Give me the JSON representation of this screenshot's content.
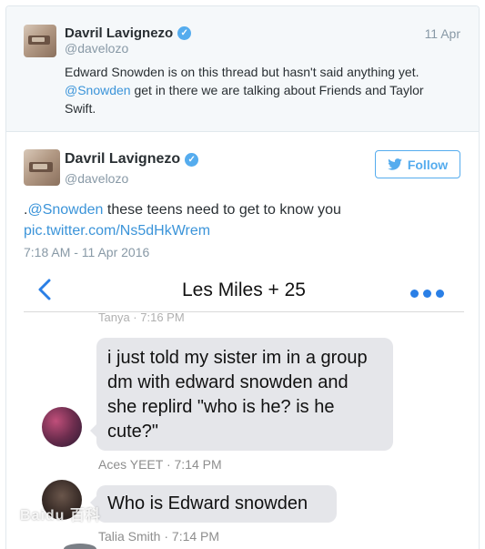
{
  "parent_tweet": {
    "author_name": "Davril Lavignezo",
    "handle": "@davelozo",
    "date": "11 Apr",
    "text_part1": "Edward Snowden is on this thread but hasn't said anything yet.",
    "mention": "@Snowden",
    "text_part2": " get in there we are talking about Friends and Taylor Swift."
  },
  "main_tweet": {
    "author_name": "Davril Lavignezo",
    "handle": "@davelozo",
    "follow_label": "Follow",
    "text_prefix": ".",
    "mention": "@Snowden",
    "text_rest": " these teens need to get to know you",
    "pic_link": "pic.twitter.com/Ns5dHkWrem",
    "timestamp": "7:18 AM - 11 Apr 2016"
  },
  "screenshot": {
    "chat_title": "Les Miles + 25",
    "faded_label": "Tanya · 7:16 PM",
    "messages": [
      {
        "text": "i just told my sister im in a group dm with edward snowden and she replird \"who is he? is he cute?\"",
        "meta": "Aces YEET · 7:14 PM"
      },
      {
        "text": "Who is Edward snowden",
        "meta": "Talia Smith · 7:14 PM"
      }
    ]
  },
  "watermark": "Baidu 百科",
  "colors": {
    "link": "#3b94d9",
    "follow": "#55acee",
    "bubble": "#e5e6ea",
    "chat_accent": "#2a7fe6"
  },
  "icons": [
    "verified-badge-icon",
    "twitter-bird-icon",
    "back-chevron-icon",
    "more-dots-icon"
  ]
}
